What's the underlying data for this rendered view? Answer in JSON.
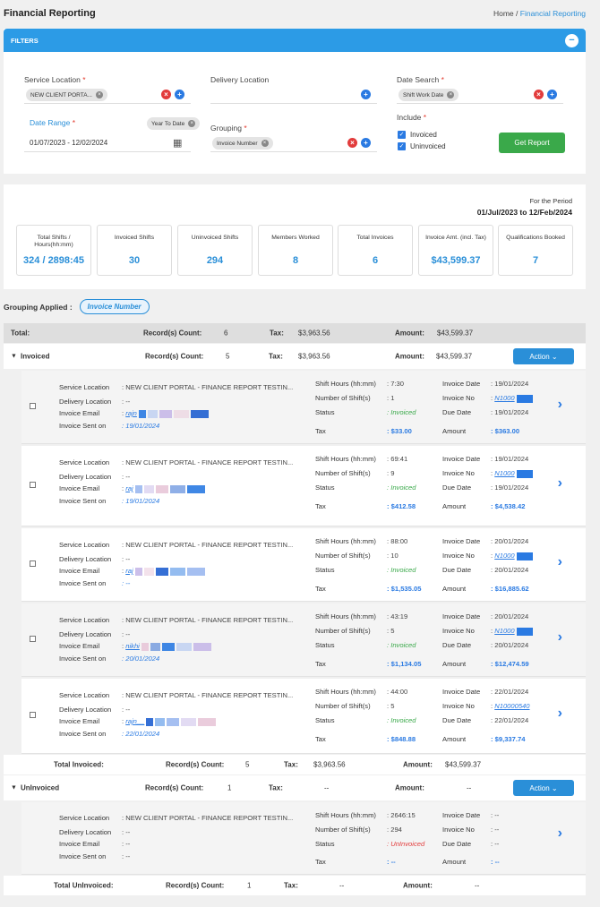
{
  "header": {
    "title": "Financial Reporting",
    "breadcrumb_home": "Home",
    "breadcrumb_sep": "/",
    "breadcrumb_current": "Financial Reporting"
  },
  "filters": {
    "bar_title": "FILTERS",
    "collapse_symbol": "−",
    "service_location": {
      "label": "Service Location",
      "chip": "NEW CLIENT PORTA..."
    },
    "delivery_location": {
      "label": "Delivery Location"
    },
    "date_search": {
      "label": "Date Search",
      "chip": "Shift Work Date"
    },
    "date_range": {
      "label": "Date Range",
      "chip": "Year To Date",
      "value": "01/07/2023 - 12/02/2024"
    },
    "grouping": {
      "label": "Grouping",
      "chip": "Invoice Number"
    },
    "include": {
      "label": "Include",
      "options": [
        "Invoiced",
        "Uninvoiced"
      ]
    },
    "required_mark": "*",
    "get_report_label": "Get Report"
  },
  "summary": {
    "period_label": "For the Period",
    "period_value": "01/Jul/2023 to 12/Feb/2024",
    "cards": [
      {
        "title": "Total Shifts / Hours(hh:mm)",
        "value": "324 / 2898:45"
      },
      {
        "title": "Invoiced Shifts",
        "value": "30"
      },
      {
        "title": "Uninvoiced Shifts",
        "value": "294"
      },
      {
        "title": "Members Worked",
        "value": "8"
      },
      {
        "title": "Total Invoices",
        "value": "6"
      },
      {
        "title": "Invoice Amt. (incl. Tax)",
        "value": "$43,599.37"
      },
      {
        "title": "Qualifications Booked",
        "value": "7"
      }
    ]
  },
  "grouping_applied": {
    "label": "Grouping Applied :",
    "value": "Invoice Number"
  },
  "labels": {
    "total": "Total:",
    "records_count": "Record(s) Count:",
    "tax": "Tax:",
    "amount": "Amount:",
    "action": "Action",
    "service_location": "Service Location",
    "delivery_location": "Delivery Location",
    "invoice_email": "Invoice Email",
    "invoice_sent_on": "Invoice Sent on",
    "shift_hours": "Shift Hours (hh:mm)",
    "number_of_shifts": "Number of Shift(s)",
    "status": "Status",
    "tax_row": "Tax",
    "invoice_date": "Invoice Date",
    "invoice_no": "Invoice No",
    "due_date": "Due Date",
    "amount_row": "Amount"
  },
  "totals": {
    "count": "6",
    "tax": "$3,963.56",
    "amount": "$43,599.37"
  },
  "invoiced_group": {
    "title": "Invoiced",
    "count": "5",
    "tax": "$3,963.56",
    "amount": "$43,599.37",
    "total_label": "Total Invoiced:",
    "total_count": "5",
    "total_tax": "$3,963.56",
    "total_amount": "$43,599.37"
  },
  "invoiced_records": [
    {
      "service_location": ": NEW CLIENT PORTAL - FINANCE REPORT TESTIN...",
      "delivery_location": ": --",
      "email": "rajn",
      "sent_on": ": 19/01/2024",
      "shift_hours": ": 7:30",
      "shifts": ": 1",
      "status": ": Invoiced",
      "tax": ": $33.00",
      "invoice_date": ": 19/01/2024",
      "invoice_no": "N1000",
      "due_date": ": 19/01/2024",
      "amount": ": $363.00"
    },
    {
      "service_location": ": NEW CLIENT PORTAL - FINANCE REPORT TESTIN...",
      "delivery_location": ": --",
      "email": "raj",
      "sent_on": ": 19/01/2024",
      "shift_hours": ": 69:41",
      "shifts": ": 9",
      "status": ": Invoiced",
      "tax": ": $412.58",
      "invoice_date": ": 19/01/2024",
      "invoice_no": "N1000",
      "due_date": ": 19/01/2024",
      "amount": ": $4,538.42"
    },
    {
      "service_location": ": NEW CLIENT PORTAL - FINANCE REPORT TESTIN...",
      "delivery_location": ": --",
      "email": "raj",
      "sent_on": ": --",
      "shift_hours": ": 88:00",
      "shifts": ": 10",
      "status": ": Invoiced",
      "tax": ": $1,535.05",
      "invoice_date": ": 20/01/2024",
      "invoice_no": "N1000",
      "due_date": ": 20/01/2024",
      "amount": ": $16,885.62"
    },
    {
      "service_location": ": NEW CLIENT PORTAL - FINANCE REPORT TESTIN...",
      "delivery_location": ": --",
      "email": "nikhi",
      "sent_on": ": 20/01/2024",
      "shift_hours": ": 43:19",
      "shifts": ": 5",
      "status": ": Invoiced",
      "tax": ": $1,134.05",
      "invoice_date": ": 20/01/2024",
      "invoice_no": "N1000",
      "due_date": ": 20/01/2024",
      "amount": ": $12,474.59"
    },
    {
      "service_location": ": NEW CLIENT PORTAL - FINANCE REPORT TESTIN...",
      "delivery_location": ": --",
      "email": "rajn__",
      "sent_on": ": 22/01/2024",
      "shift_hours": ": 44:00",
      "shifts": ": 5",
      "status": ": Invoiced",
      "tax": ": $848.88",
      "invoice_date": ": 22/01/2024",
      "invoice_no": "N10000540",
      "due_date": ": 22/01/2024",
      "amount": ": $9,337.74"
    }
  ],
  "uninvoiced_group": {
    "title": "UnInvoiced",
    "count": "1",
    "tax": "--",
    "amount": "--",
    "total_label": "Total UnInvoiced:",
    "total_count": "1",
    "total_tax": "--",
    "total_amount": "--"
  },
  "uninvoiced_record": {
    "service_location": ": NEW CLIENT PORTAL - FINANCE REPORT TESTIN...",
    "delivery_location": ": --",
    "email": ": --",
    "sent_on": ": --",
    "shift_hours": ": 2646:15",
    "shifts": ": 294",
    "status": ": UnInvoiced",
    "tax": ": --",
    "invoice_date": ": --",
    "invoice_no": ": --",
    "due_date": ": --",
    "amount": ": --"
  },
  "colors": {
    "accent": "#2a8fd8",
    "filters_bar": "#2c9be6",
    "get_report": "#3aa94a",
    "invoiced_status": "#3aa94a",
    "uninvoiced_status": "#e23c3c"
  }
}
